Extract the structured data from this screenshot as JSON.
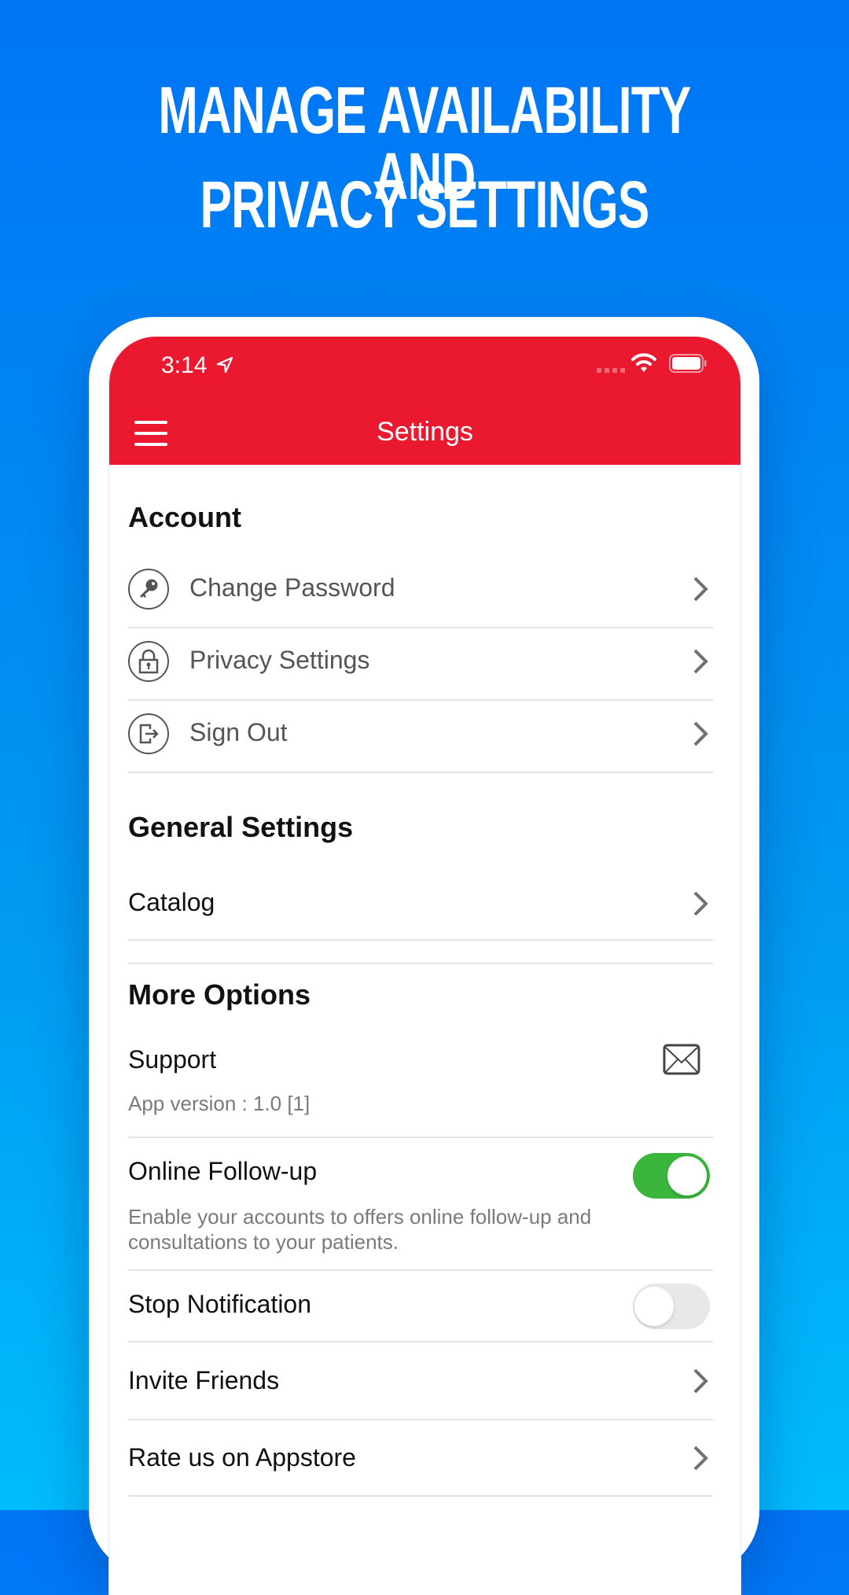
{
  "headline": {
    "line1": "MANAGE AVAILABILITY AND",
    "line2": "PRIVACY SETTINGS"
  },
  "status_bar": {
    "time": "3:14",
    "icons": [
      "location-arrow-icon",
      "signal-icon",
      "wifi-icon",
      "battery-icon"
    ]
  },
  "nav": {
    "title": "Settings",
    "menu_icon": "hamburger-menu-icon"
  },
  "sections": {
    "account": {
      "title": "Account",
      "items": [
        {
          "label": "Change Password",
          "icon": "key-icon"
        },
        {
          "label": "Privacy Settings",
          "icon": "lock-icon"
        },
        {
          "label": "Sign Out",
          "icon": "sign-out-icon"
        }
      ]
    },
    "general": {
      "title": "General Settings",
      "items": [
        {
          "label": "Catalog"
        }
      ]
    },
    "more": {
      "title": "More Options",
      "support": {
        "label": "Support",
        "version": "App version : 1.0 [1]",
        "icon": "mail-icon"
      },
      "online_followup": {
        "label": "Online Follow-up",
        "description_line1": "Enable your accounts to offers online follow-up and",
        "description_line2": "consultations to your patients.",
        "enabled": true
      },
      "stop_notification": {
        "label": "Stop Notification",
        "enabled": false
      },
      "items": [
        {
          "label": "Invite Friends"
        },
        {
          "label": "Rate us on Appstore"
        }
      ]
    }
  },
  "colors": {
    "header_red": "#eb1930",
    "toggle_on": "#3bb53b",
    "background_blue_top": "#0075f6",
    "background_blue_bottom": "#00bdfd"
  }
}
